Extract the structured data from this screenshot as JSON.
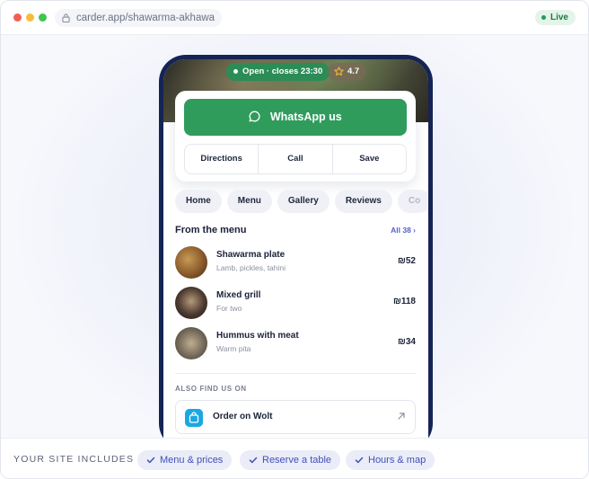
{
  "browser": {
    "url": "carder.app/shawarma-akhawa",
    "status": "Live"
  },
  "hero": {
    "open_status": "Open · closes 23:30",
    "rating": "4.7"
  },
  "actions": {
    "whatsapp": "WhatsApp us",
    "directions": "Directions",
    "call": "Call",
    "save": "Save"
  },
  "tabs": [
    "Home",
    "Menu",
    "Gallery",
    "Reviews",
    "Co"
  ],
  "menu_section": {
    "title": "From the menu",
    "all_link": "All 38 ›",
    "items": [
      {
        "name": "Shawarma plate",
        "desc": "Lamb, pickles, tahini",
        "price": "₪52"
      },
      {
        "name": "Mixed grill",
        "desc": "For two",
        "price": "₪118"
      },
      {
        "name": "Hummus with meat",
        "desc": "Warm pita",
        "price": "₪34"
      }
    ]
  },
  "also": {
    "label": "ALSO FIND US ON",
    "wolt": "Order on Wolt"
  },
  "footer": {
    "label": "YOUR SITE INCLUDES",
    "chips": [
      "Menu & prices",
      "Reserve a table",
      "Hours & map"
    ]
  },
  "colors": {
    "whatsapp_green": "#2f9c5c",
    "phone_frame": "#142455",
    "accent": "#4250b8",
    "wolt_blue": "#1ba8e2"
  },
  "icons": {
    "lock": "lock-icon",
    "star": "star-icon",
    "chat": "chat-bubble-icon",
    "bag": "shopping-bag-icon",
    "external": "arrow-up-right-icon",
    "check": "check-icon"
  }
}
